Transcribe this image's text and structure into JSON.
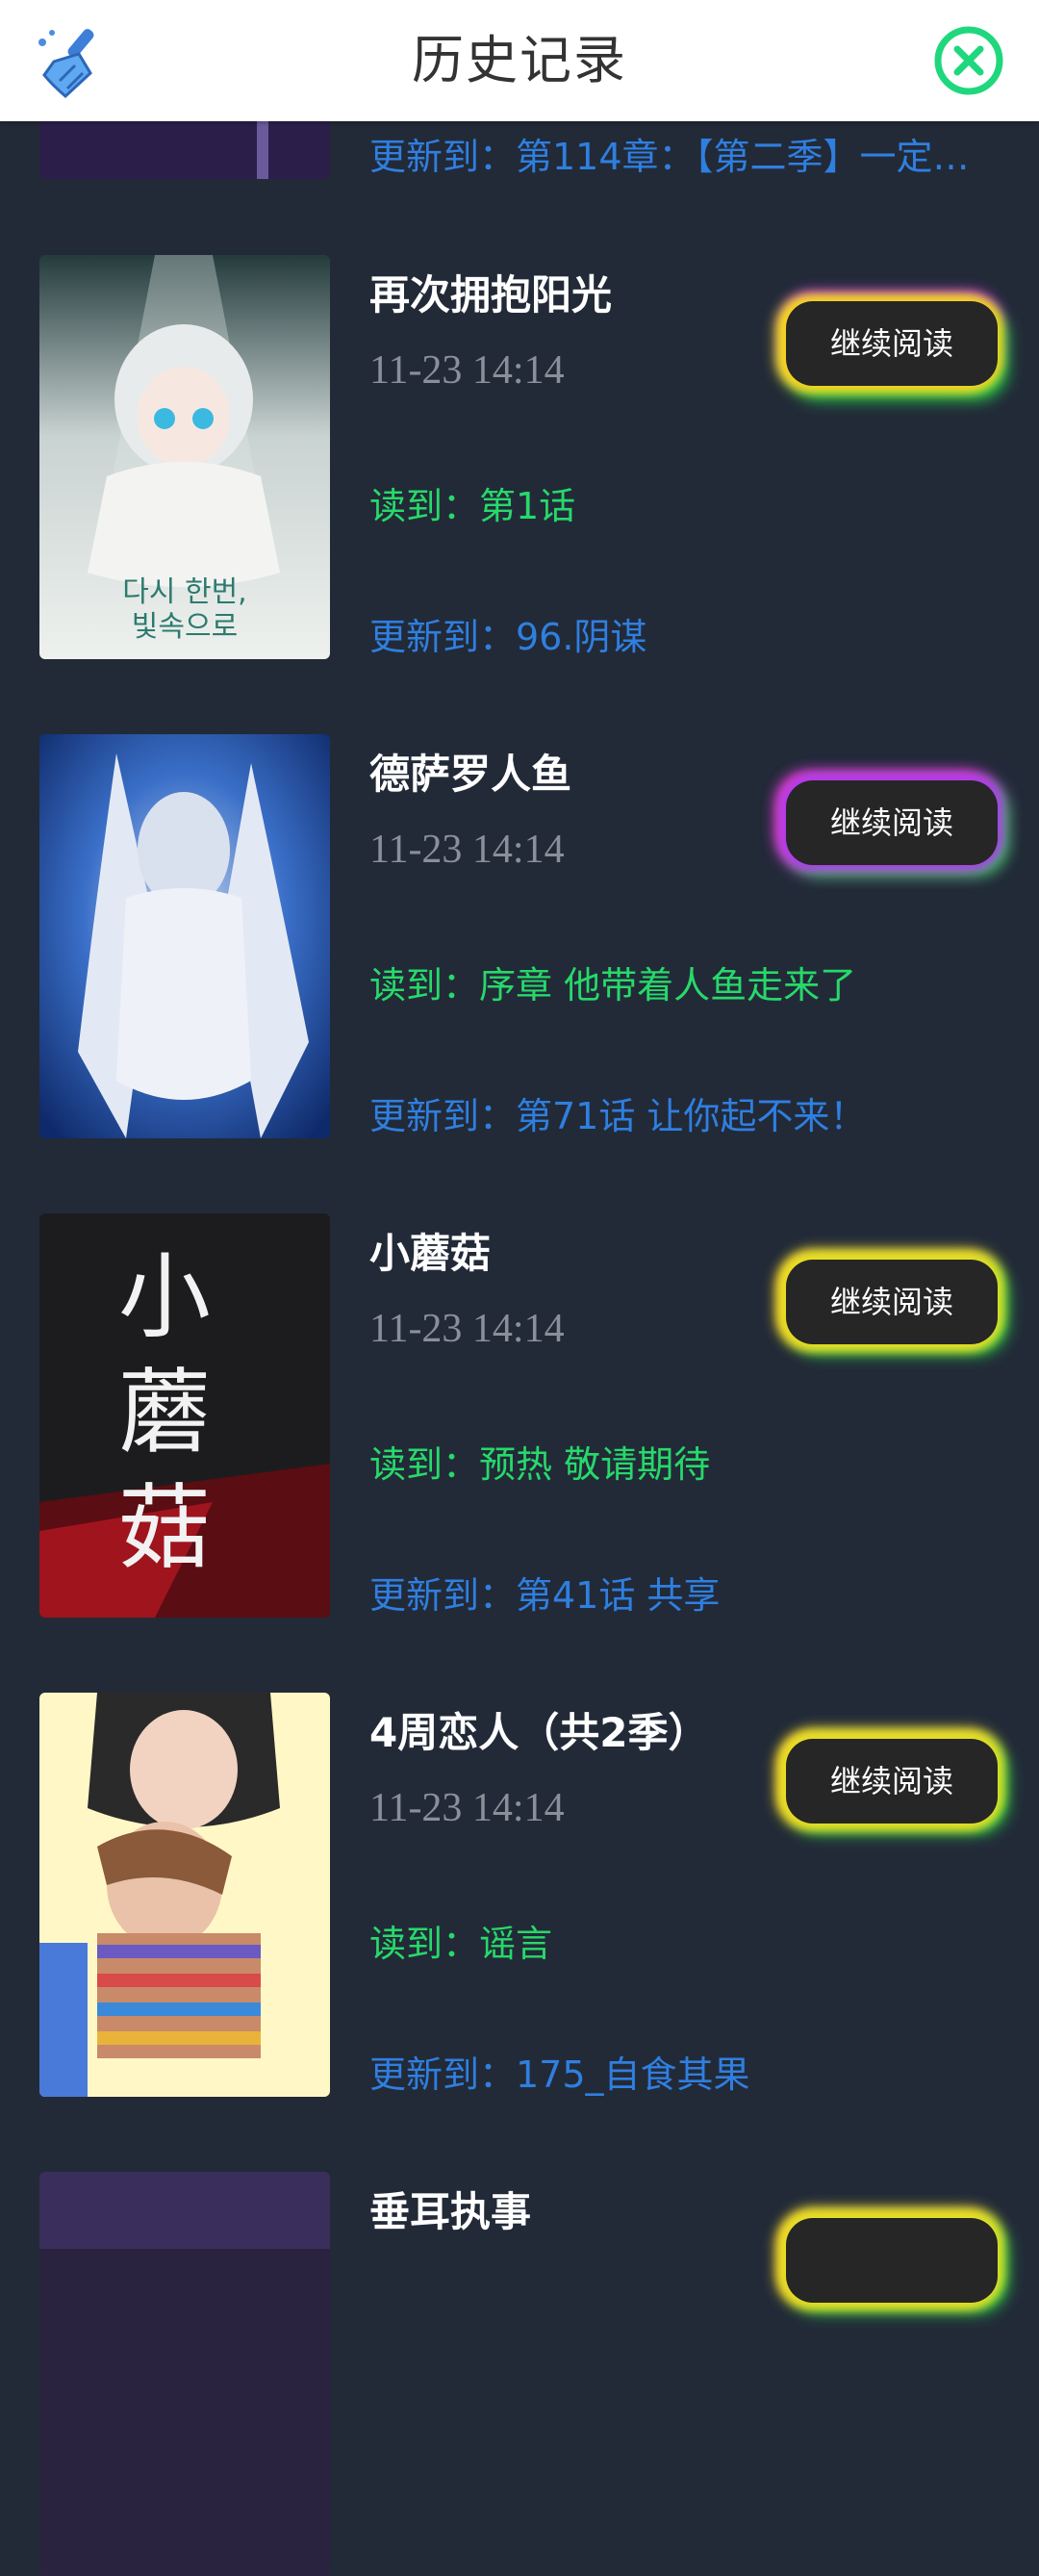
{
  "header": {
    "title": "历史记录",
    "clear_icon": "broom-icon",
    "close_icon": "close-circle-icon",
    "accent_color": "#1fd77d"
  },
  "top_partial": {
    "update": "更新到：第114章：【第二季】一定…"
  },
  "items": [
    {
      "name": "再次拥抱阳光",
      "time": "11-23 14:14",
      "read": "读到：第1话",
      "update": "更新到：96.阴谋",
      "button": "继续阅读",
      "cover_text_1": "다시 한번,",
      "cover_text_2": "빛속으로"
    },
    {
      "name": "德萨罗人鱼",
      "time": "11-23 14:14",
      "read": "读到：序章 他带着人鱼走来了",
      "update": "更新到：第71话 让你起不来！",
      "button": "继续阅读"
    },
    {
      "name": "小蘑菇",
      "time": "11-23 14:14",
      "read": "读到：预热 敬请期待",
      "update": "更新到：第41话 共享",
      "button": "继续阅读",
      "cover_text_1": "小",
      "cover_text_2": "蘑",
      "cover_text_3": "菇"
    },
    {
      "name": "4周恋人（共2季）",
      "time": "11-23 14:14",
      "read": "读到：谣言",
      "update": "更新到：175_自食其果",
      "button": "继续阅读"
    },
    {
      "name": "垂耳执事"
    }
  ]
}
